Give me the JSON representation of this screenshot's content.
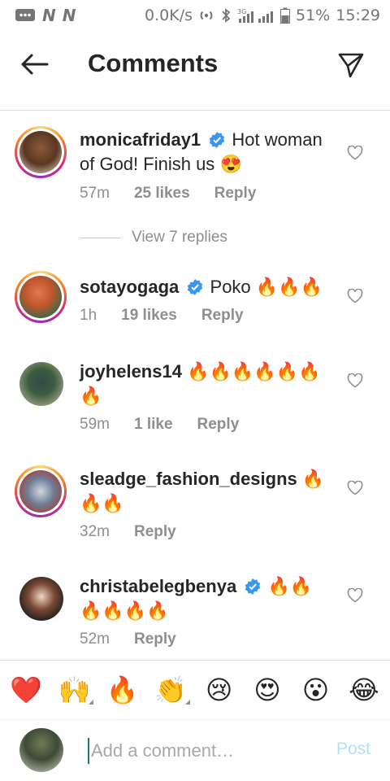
{
  "status_bar": {
    "carrier_icons": [
      "N",
      "N"
    ],
    "speed": "0.0K/s",
    "network": "3G",
    "battery": "51%",
    "time": "15:29"
  },
  "header": {
    "title": "Comments"
  },
  "comments": [
    {
      "username": "monicafriday1",
      "verified": true,
      "text": "Hot woman of God! Finish us",
      "emoji_suffix": "😍",
      "time": "57m",
      "likes": "25 likes",
      "reply": "Reply",
      "view_replies": "View 7 replies"
    },
    {
      "username": "sotayogaga",
      "verified": true,
      "text": "Poko",
      "emoji_suffix": "🔥🔥🔥",
      "time": "1h",
      "likes": "19 likes",
      "reply": "Reply"
    },
    {
      "username": "joyhelens14",
      "verified": false,
      "text": "",
      "emoji_suffix": "🔥🔥🔥🔥🔥🔥🔥",
      "time": "59m",
      "likes": "1 like",
      "reply": "Reply"
    },
    {
      "username": "sleadge_fashion_designs",
      "verified": false,
      "text": "",
      "emoji_suffix": "🔥🔥🔥",
      "time": "32m",
      "likes": "",
      "reply": "Reply"
    },
    {
      "username": "christabelegbenya",
      "verified": true,
      "text": "",
      "emoji_suffix": "🔥🔥🔥🔥🔥🔥",
      "time": "52m",
      "likes": "",
      "reply": "Reply"
    }
  ],
  "emoji_bar": [
    "❤️",
    "🙌",
    "🔥",
    "👏",
    "😢",
    "😍",
    "😮",
    "😂"
  ],
  "input": {
    "placeholder": "Add a comment…",
    "post_label": "Post"
  },
  "colors": {
    "accent_verified": "#3897f0",
    "post_disabled": "#b2dffc",
    "secondary_text": "#8e8e8e"
  }
}
